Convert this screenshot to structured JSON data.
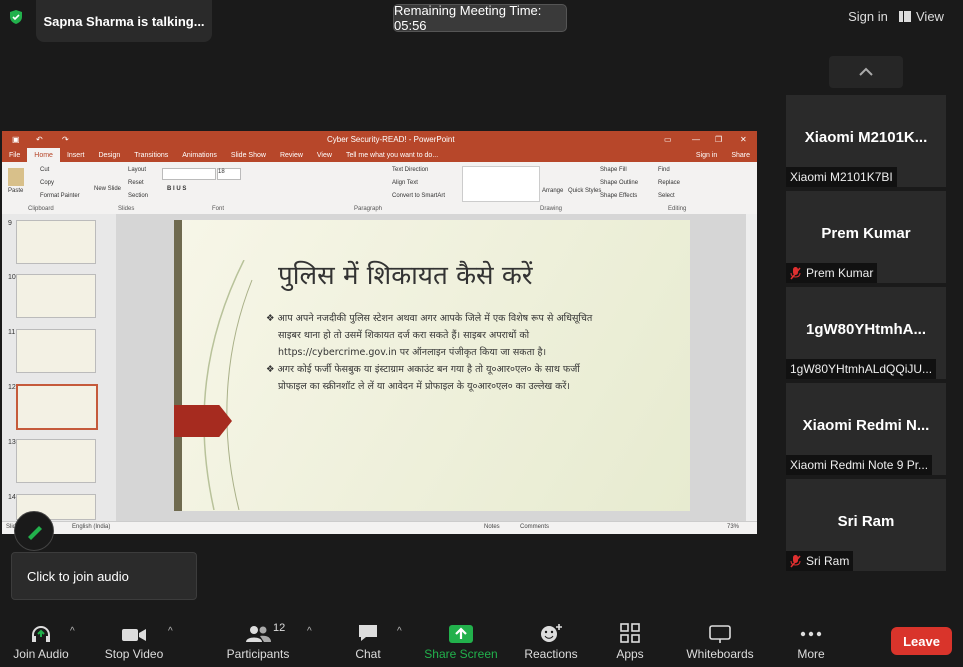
{
  "header": {
    "talking_text": "Sapna Sharma is talking...",
    "meeting_time": "Remaining Meeting Time: 05:56",
    "sign_in": "Sign in",
    "view": "View"
  },
  "participants": [
    {
      "name": "Xiaomi  M2101K...",
      "label": "Xiaomi M2101K7BI",
      "muted": false
    },
    {
      "name": "Prem Kumar",
      "label": "Prem Kumar",
      "muted": true
    },
    {
      "name": "1gW80YHtmhA...",
      "label": "1gW80YHtmhALdQQiJU...",
      "muted": false
    },
    {
      "name": "Xiaomi Redmi N...",
      "label": "Xiaomi Redmi Note 9 Pr...",
      "muted": false
    },
    {
      "name": "Sri Ram",
      "label": "Sri Ram",
      "muted": true
    }
  ],
  "powerpoint": {
    "title": "Cyber Security-READ! - PowerPoint",
    "signin": "Sign in",
    "share": "Share",
    "tabs": [
      "File",
      "Home",
      "Insert",
      "Design",
      "Transitions",
      "Animations",
      "Slide Show",
      "Review",
      "View"
    ],
    "tell_me": "Tell me what you want to do...",
    "groups": [
      "Clipboard",
      "Slides",
      "Font",
      "Paragraph",
      "Drawing",
      "Editing"
    ],
    "clipboard": {
      "paste": "Paste",
      "cut": "Cut",
      "copy": "Copy",
      "format_painter": "Format Painter"
    },
    "slides_grp": {
      "new_slide": "New Slide",
      "layout": "Layout",
      "reset": "Reset",
      "section": "Section"
    },
    "drawing": {
      "arrange": "Arrange",
      "quick_styles": "Quick Styles",
      "shape_fill": "Shape Fill",
      "shape_outline": "Shape Outline",
      "shape_effects": "Shape Effects"
    },
    "editing": {
      "find": "Find",
      "replace": "Replace",
      "select": "Select"
    },
    "paragraph": {
      "text_direction": "Text Direction",
      "align_text": "Align Text",
      "convert": "Convert to SmartArt"
    },
    "font_size": "18",
    "thumb_numbers": [
      "9",
      "10",
      "11",
      "12",
      "13",
      "14"
    ],
    "slide_title": "पुलिस में शिकायत कैसे करें",
    "bullet1": "आप अपने नजदीकी पुलिस स्टेशन अथवा अगर आपके जिले में एक विशेष रूप से अधिसूचित साइबर थाना हो तो उसमें शिकायत दर्ज करा सकते हैं। साइबर अपराधों को https://cybercrime.gov.in पर ऑनलाइन पंजीकृत किया जा सकता है।",
    "bullet2": "अगर कोई फर्जी फेसबुक या इंस्टाग्राम अकाउंट बन गया है तो यू०आर०एल० के साथ फर्जी प्रोफाइल का स्क्रीनशॉट ले लें या आवेदन में प्रोफाइल के यू०आर०एल० का उल्लेख करें।",
    "status_language": "English (India)",
    "status_slide": "Slide",
    "notes": "Notes",
    "comments": "Comments",
    "zoom": "73%"
  },
  "tooltip": "Click to join audio",
  "toolbar": {
    "join_audio": "Join Audio",
    "stop_video": "Stop Video",
    "participants": "Participants",
    "participants_count": "12",
    "chat": "Chat",
    "share_screen": "Share Screen",
    "reactions": "Reactions",
    "apps": "Apps",
    "whiteboards": "Whiteboards",
    "more": "More",
    "leave": "Leave"
  },
  "colors": {
    "share_green": "#22b14c",
    "leave_red": "#d9342b",
    "ppt_brand": "#b7472a",
    "security_green": "#22b14c"
  }
}
